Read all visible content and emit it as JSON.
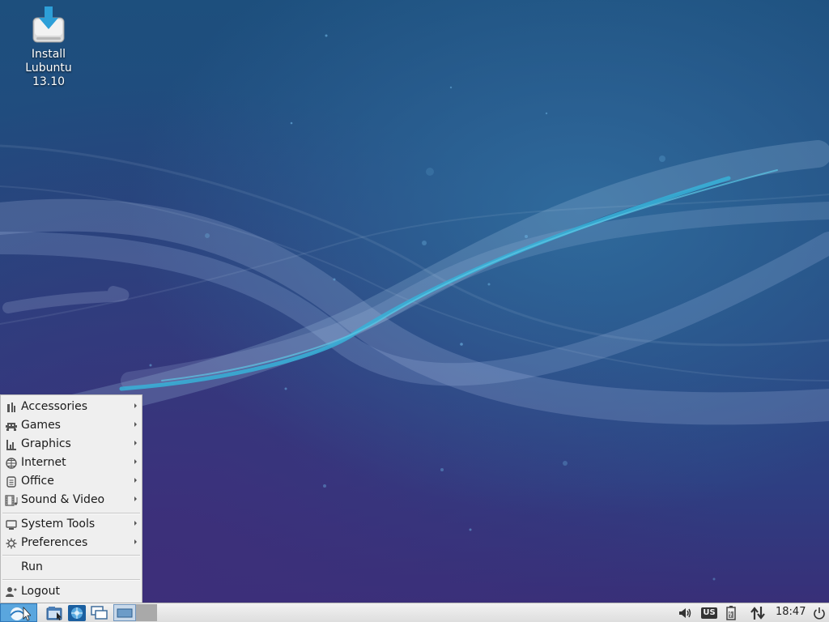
{
  "desktop": {
    "icons": [
      {
        "label_line1": "Install",
        "label_line2": "Lubuntu 13.10",
        "icon": "installer-download-icon"
      }
    ]
  },
  "menu": {
    "items": [
      {
        "label": "Accessories",
        "icon": "accessories-icon",
        "submenu": true
      },
      {
        "label": "Games",
        "icon": "games-icon",
        "submenu": true
      },
      {
        "label": "Graphics",
        "icon": "graphics-icon",
        "submenu": true
      },
      {
        "label": "Internet",
        "icon": "internet-globe-icon",
        "submenu": true
      },
      {
        "label": "Office",
        "icon": "office-document-icon",
        "submenu": true
      },
      {
        "label": "Sound & Video",
        "icon": "sound-video-icon",
        "submenu": true
      },
      {
        "label": "System Tools",
        "icon": "system-tools-monitor-icon",
        "submenu": true
      },
      {
        "label": "Preferences",
        "icon": "preferences-gear-icon",
        "submenu": true
      },
      {
        "label": "Run",
        "icon": "",
        "submenu": false
      },
      {
        "label": "Logout",
        "icon": "logout-user-icon",
        "submenu": false
      }
    ]
  },
  "taskbar": {
    "clock": "18:47",
    "keyboard_layout": "US",
    "tray_icons": [
      "volume-icon",
      "keyboard-layout-icon",
      "battery-icon",
      "network-transfer-icon",
      "power-icon"
    ],
    "launchers": [
      "menu-logo-icon",
      "file-manager-icon",
      "web-browser-icon",
      "show-desktop-icon",
      "workspace-1-icon"
    ]
  },
  "colors": {
    "desktop_top": "#1d4f7d",
    "desktop_bottom": "#382f78",
    "menu_bg": "#efefef",
    "taskbar_bg": "#e6e6e6",
    "accent": "#2f9fd0"
  }
}
